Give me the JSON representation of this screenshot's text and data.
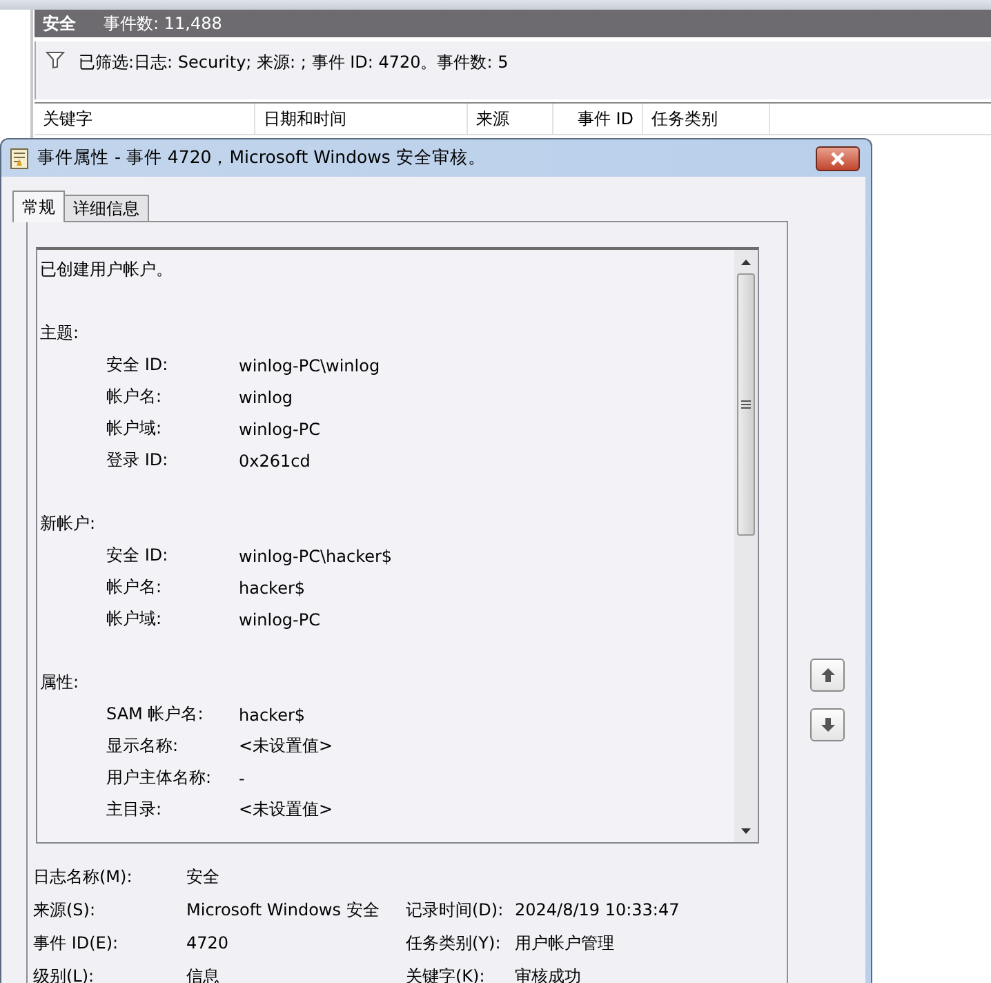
{
  "log_header": {
    "name": "安全",
    "count": "事件数: 11,488"
  },
  "filter": {
    "text": "已筛选:日志: Security; 来源: ; 事件 ID: 4720。事件数: 5"
  },
  "columns": [
    {
      "label": "关键字"
    },
    {
      "label": "日期和时间"
    },
    {
      "label": "来源"
    },
    {
      "label": "事件 ID"
    },
    {
      "label": "任务类别"
    }
  ],
  "dialog": {
    "title": "事件属性 - 事件 4720，Microsoft Windows 安全审核。",
    "tabs": [
      {
        "label": "常规",
        "selected": true
      },
      {
        "label": "详细信息",
        "selected": false
      }
    ],
    "description": {
      "intro": "已创建用户帐户。",
      "sections": [
        {
          "title": "主题:",
          "fields": [
            {
              "label": "安全 ID:",
              "value": "winlog-PC\\winlog"
            },
            {
              "label": "帐户名:",
              "value": "winlog"
            },
            {
              "label": "帐户域:",
              "value": "winlog-PC"
            },
            {
              "label": "登录 ID:",
              "value": "0x261cd"
            }
          ]
        },
        {
          "title": "新帐户:",
          "fields": [
            {
              "label": "安全 ID:",
              "value": "winlog-PC\\hacker$"
            },
            {
              "label": "帐户名:",
              "value": "hacker$"
            },
            {
              "label": "帐户域:",
              "value": "winlog-PC"
            }
          ]
        },
        {
          "title": "属性:",
          "fields": [
            {
              "label": "SAM 帐户名:",
              "value": "hacker$"
            },
            {
              "label": "显示名称:",
              "value": "<未设置值>"
            },
            {
              "label": "用户主体名称:",
              "value": "-"
            },
            {
              "label": "主目录:",
              "value": "<未设置值>"
            }
          ]
        }
      ]
    },
    "properties": [
      {
        "label": "日志名称(M):",
        "value": "安全"
      },
      {
        "label": "来源(S):",
        "value": "Microsoft Windows 安全",
        "label2": "记录时间(D):",
        "value2": "2024/8/19 10:33:47"
      },
      {
        "label": "事件 ID(E):",
        "value": "4720",
        "label2": "任务类别(Y):",
        "value2": "用户帐户管理"
      },
      {
        "label": "级别(L):",
        "value": "信息",
        "label2": "关键字(K):",
        "value2": "审核成功"
      }
    ]
  }
}
